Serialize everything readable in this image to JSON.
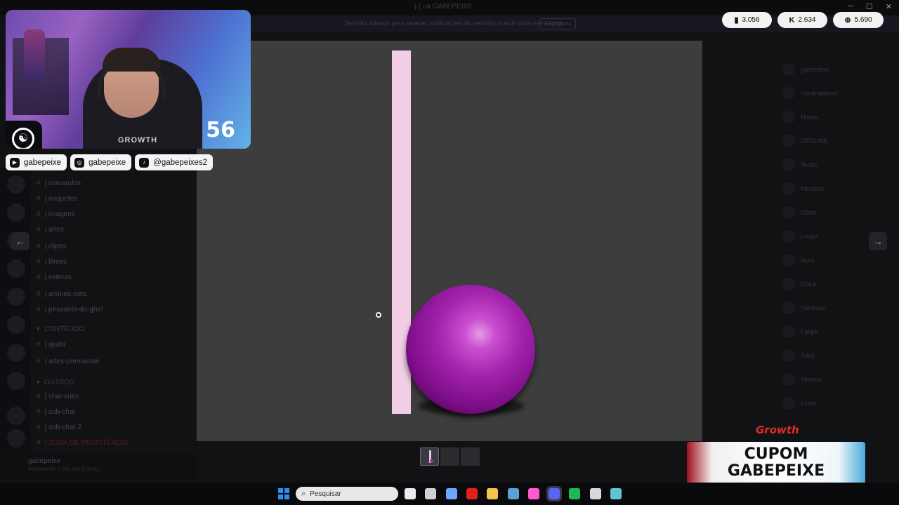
{
  "window": {
    "title": "[-] ua GABEPEIXE"
  },
  "banner": {
    "text": "Servidor ativado para receber notificações do servidor mande uma mensagem",
    "button": "Configurar"
  },
  "stats": [
    {
      "icon": "twitch-icon",
      "glyph": "▮",
      "value": "3.056"
    },
    {
      "icon": "kick-icon",
      "glyph": "K",
      "value": "2.634"
    },
    {
      "icon": "globe-icon",
      "glyph": "⊕",
      "value": "5.690"
    }
  ],
  "webcam": {
    "counter": "56",
    "shirt_text": "GROWTH"
  },
  "socials": [
    {
      "icon": "youtube-icon",
      "glyph": "▶",
      "handle": "gabepeixe"
    },
    {
      "icon": "instagram-icon",
      "glyph": "◎",
      "handle": "gabepeixe"
    },
    {
      "icon": "tiktok-icon",
      "glyph": "♪",
      "handle": "@gabepeixes2"
    }
  ],
  "channels": [
    {
      "name": "| comandos",
      "type": "text"
    },
    {
      "name": "| enquetes",
      "type": "text"
    },
    {
      "name": "| imagens",
      "type": "text"
    },
    {
      "name": "| artes",
      "type": "text"
    },
    {
      "name": "| clipes",
      "type": "text"
    },
    {
      "name": "| filmes",
      "type": "text"
    },
    {
      "name": "| esteras",
      "type": "text"
    },
    {
      "name": "| animes-pets",
      "type": "text"
    },
    {
      "name": "| pesadelo-do-ghel",
      "type": "text"
    },
    {
      "name": "CONTEUDO",
      "type": "category"
    },
    {
      "name": "| ajuda",
      "type": "text"
    },
    {
      "name": "| artes-premiadas",
      "type": "text"
    },
    {
      "name": "OUTROS",
      "type": "category"
    },
    {
      "name": "| chat-subs",
      "type": "text"
    },
    {
      "name": "| sub-chat",
      "type": "text"
    },
    {
      "name": "| sub-chat-2",
      "type": "text"
    },
    {
      "name": "| ZONA DE RESISTÊNCIA",
      "type": "red"
    }
  ],
  "user": {
    "name": "gabepeixe",
    "status": "Acessando o Rio em Entrou..."
  },
  "members": [
    "gabepeixe",
    "moderadores",
    "Nome",
    "OFFLINE",
    "Todos",
    "Membro",
    "Gabe",
    "Lucas",
    "Ikuro",
    "Clara",
    "Vanessa",
    "Felipe",
    "Atlas",
    "Marcos",
    "Linha"
  ],
  "viewer": {
    "thumbnails": 3
  },
  "sponsor": {
    "brand": "Growth",
    "line1": "CUPOM",
    "line2": "GABEPEIXE"
  },
  "taskbar": {
    "search_placeholder": "Pesquisar",
    "apps": [
      {
        "icon": "file-explorer-icon",
        "color": "#e9eaed"
      },
      {
        "icon": "game-icon",
        "color": "#cfcfd4"
      },
      {
        "icon": "copilot-icon",
        "color": "#6aa8ff"
      },
      {
        "icon": "opera-icon",
        "color": "#e0201e"
      },
      {
        "icon": "folder-icon",
        "color": "#f2c44a"
      },
      {
        "icon": "steam-icon",
        "color": "#5aa0d0"
      },
      {
        "icon": "capcut-icon",
        "color": "#ff5ad2"
      },
      {
        "icon": "discord-icon",
        "color": "#5865f2"
      },
      {
        "icon": "spotify-icon",
        "color": "#1db954"
      },
      {
        "icon": "obs-icon",
        "color": "#d8d8dc"
      },
      {
        "icon": "app-icon",
        "color": "#5fc6d0"
      }
    ]
  },
  "colors": {
    "viewer_bg": "#3d3d3d",
    "pillar": "#f1cde6",
    "sphere": "#a323ad",
    "coupon_red": "#a0101c",
    "growth_red": "#e02a2a"
  }
}
